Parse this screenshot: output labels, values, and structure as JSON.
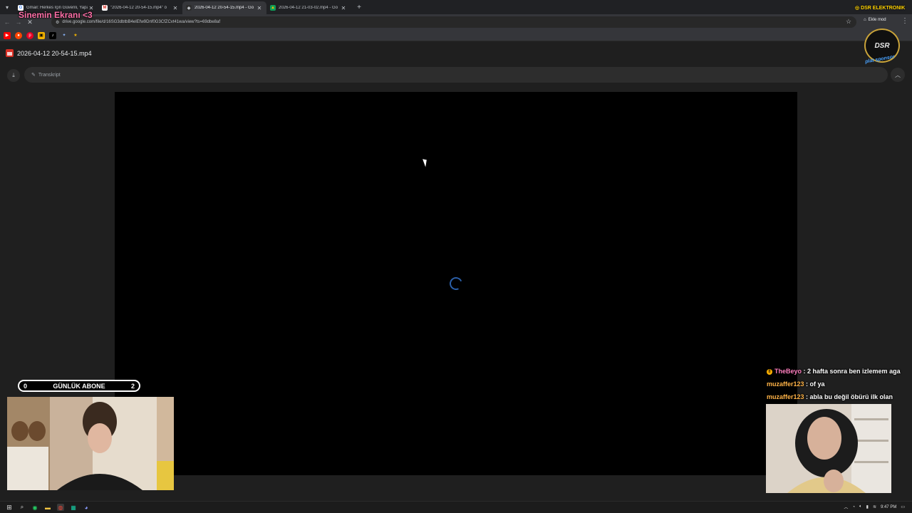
{
  "browser": {
    "tabs": [
      {
        "title": "Gmail: Herkes İçin Güvenli, Yapa",
        "icon": "google-icon",
        "active": false
      },
      {
        "title": "\"2026-04-12 20-54-15.mp4\" ö",
        "icon": "gmail-icon",
        "active": false
      },
      {
        "title": "2026-04-12 20-54-15.mp4 - Go",
        "icon": "drive-icon",
        "active": true
      },
      {
        "title": "2026-04-12 21-03-02.mp4 - Go",
        "icon": "drive-icon",
        "active": false
      }
    ],
    "url": "drive.google.com/file/d/16SG3dbtbB4eIEfw9Dnf0G3CfZCvt41wa/view?ts=69dbe8af",
    "profile_label": "Ekle mod"
  },
  "viewer": {
    "file_name": "2026-04-12 20-54-15.mp4",
    "transcript_label": "Transkript"
  },
  "overlay": {
    "stream_title": "Sinemin Ekranı <3",
    "sponsor_text": "DSR ELEKTRONIK",
    "badge_text": "DSR",
    "badge_sub": "plat sponsor",
    "abone": {
      "left": "0",
      "label": "GÜNLÜK ABONE",
      "right": "2"
    }
  },
  "chat": [
    {
      "user": "TheBeyo",
      "message": ": 2 hafta sonra ben izlemem aga"
    },
    {
      "user": "muzaffer123",
      "message": ": of ya"
    },
    {
      "user": "muzaffer123",
      "message": ": abla bu değil öbürü ilk olan"
    }
  ],
  "taskbar": {
    "time": "9:47 PM"
  },
  "colors": {
    "accent_pink": "#ff6fa8",
    "chat_user_orange": "#ffb347",
    "spinner_blue": "#2b5fa8"
  }
}
